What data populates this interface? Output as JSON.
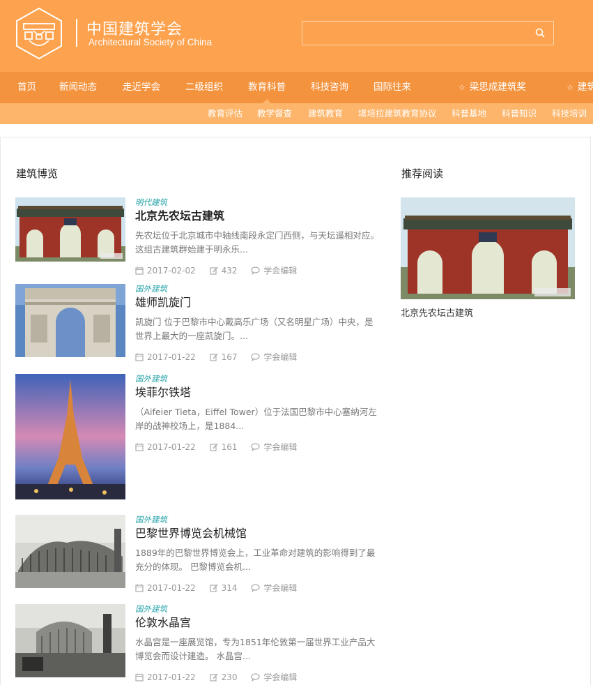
{
  "header": {
    "logo_cn": "中国建筑学会",
    "logo_en": "Architectural Society of China",
    "search_placeholder": ""
  },
  "nav": {
    "items": [
      {
        "label": "首页"
      },
      {
        "label": "新闻动态"
      },
      {
        "label": "走近学会"
      },
      {
        "label": "二级组织"
      },
      {
        "label": "教育科普",
        "active": true
      },
      {
        "label": "科技咨询"
      },
      {
        "label": "国际往来"
      },
      {
        "label": "梁思成建筑奖"
      },
      {
        "label": "建筑"
      }
    ]
  },
  "subnav": {
    "items": [
      {
        "label": "教育评估"
      },
      {
        "label": "教学督查"
      },
      {
        "label": "建筑教育"
      },
      {
        "label": "堪培拉建筑教育协议"
      },
      {
        "label": "科普基地"
      },
      {
        "label": "科普知识"
      },
      {
        "label": "科技培训"
      }
    ]
  },
  "main": {
    "section_title": "建筑博览",
    "articles": [
      {
        "category": "明代建筑",
        "title": "北京先农坛古建筑",
        "excerpt": "先农坛位于北京城市中轴线南段永定门西侧，与天坛遥相对应。这组古建筑群始建于明永乐...",
        "date": "2017-02-02",
        "views": "432",
        "author": "学会编辑"
      },
      {
        "category": "国外建筑",
        "title": "雄师凯旋门",
        "excerpt": "凯旋门 位于巴黎市中心戴高乐广场（又名明星广场）中央，是世界上最大的一座凯旋门。...",
        "date": "2017-01-22",
        "views": "167",
        "author": "学会编辑"
      },
      {
        "category": "国外建筑",
        "title": "埃菲尔铁塔",
        "excerpt": "（Aifeier Tieta，Eiffel Tower）位于法国巴黎市中心塞纳河左岸的战神校场上，是1884...",
        "date": "2017-01-22",
        "views": "161",
        "author": "学会编辑"
      },
      {
        "category": "国外建筑",
        "title": "巴黎世界博览会机械馆",
        "excerpt": "1889年的巴黎世界博览会上，工业革命对建筑的影响得到了最充分的体现。 巴黎博览会机...",
        "date": "2017-01-22",
        "views": "314",
        "author": "学会编辑"
      },
      {
        "category": "国外建筑",
        "title": "伦敦水晶宫",
        "excerpt": "水晶宫是一座展览馆，专为1851年伦敦第一届世界工业产品大博览会而设计建造。 水晶宫...",
        "date": "2017-01-22",
        "views": "230",
        "author": "学会编辑"
      }
    ]
  },
  "sidebar": {
    "section_title": "推荐阅读",
    "recommend_title": "北京先农坛古建筑"
  },
  "colors": {
    "header_bg": "#fda24e",
    "nav_bg": "#f4933e",
    "subnav_bg": "#fcb56a",
    "category_color": "#25a3a8"
  }
}
